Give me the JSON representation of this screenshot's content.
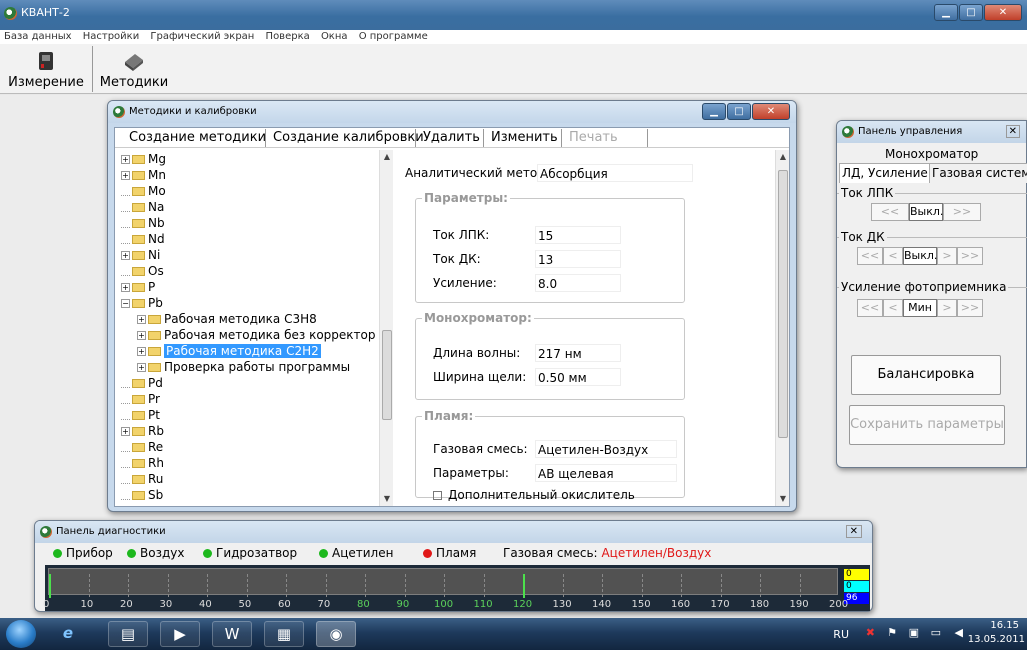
{
  "app": {
    "title": "КВАНТ-2"
  },
  "menu": [
    "База данных",
    "Настройки",
    "Графический экран",
    "Поверка",
    "Окна",
    "О программе"
  ],
  "toolbar": {
    "measure": "Измерение",
    "methods": "Методики"
  },
  "methods_window": {
    "title": "Методики и калибровки",
    "tabs": [
      "Создание методики",
      "Создание калибровки",
      "Удалить",
      "Изменить",
      "Печать"
    ],
    "tree": [
      {
        "label": "Mg",
        "expand": true,
        "level": 0
      },
      {
        "label": "Mn",
        "expand": true,
        "level": 0
      },
      {
        "label": "Mo",
        "expand": false,
        "level": 0
      },
      {
        "label": "Na",
        "expand": false,
        "level": 0
      },
      {
        "label": "Nb",
        "expand": false,
        "level": 0
      },
      {
        "label": "Nd",
        "expand": false,
        "level": 0
      },
      {
        "label": "Ni",
        "expand": true,
        "level": 0
      },
      {
        "label": "Os",
        "expand": false,
        "level": 0
      },
      {
        "label": "P",
        "expand": true,
        "level": 0
      },
      {
        "label": "Pb",
        "expand": true,
        "level": 0
      },
      {
        "label": "Рабочая методика C3H8",
        "expand": true,
        "level": 1
      },
      {
        "label": "Рабочая методика без корректор",
        "expand": true,
        "level": 1
      },
      {
        "label": "Рабочая методика C2H2",
        "expand": true,
        "level": 1,
        "selected": true
      },
      {
        "label": "Проверка работы программы",
        "expand": true,
        "level": 1
      },
      {
        "label": "Pd",
        "expand": false,
        "level": 0
      },
      {
        "label": "Pr",
        "expand": false,
        "level": 0
      },
      {
        "label": "Pt",
        "expand": false,
        "level": 0
      },
      {
        "label": "Rb",
        "expand": true,
        "level": 0
      },
      {
        "label": "Re",
        "expand": false,
        "level": 0
      },
      {
        "label": "Rh",
        "expand": false,
        "level": 0
      },
      {
        "label": "Ru",
        "expand": false,
        "level": 0
      },
      {
        "label": "Sb",
        "expand": false,
        "level": 0
      }
    ],
    "method_label": "Аналитический метод:",
    "method_value": "Абсорбция",
    "params_group": "Параметры:",
    "lpk_label": "Ток ЛПК:",
    "lpk_value": "15",
    "dk_label": "Ток ДК:",
    "dk_value": "13",
    "gain_label": "Усиление:",
    "gain_value": "8.0",
    "mono_group": "Монохроматор:",
    "wave_label": "Длина волны:",
    "wave_value": "217 нм",
    "slit_label": "Ширина щели:",
    "slit_value": "0.50 мм",
    "flame_group": "Пламя:",
    "gas_label": "Газовая смесь:",
    "gas_value": "Ацетилен-Воздух",
    "fparams_label": "Параметры:",
    "fparams_value": "АВ щелевая",
    "oxidizer_label": "Дополнительный окислитель"
  },
  "control_panel": {
    "title": "Панель управления",
    "heading": "Монохроматор",
    "tab1": "ЛД, Усиление",
    "tab2": "Газовая система",
    "lpk_group": "Ток ЛПК",
    "lpk_btns": [
      "<<",
      "Выкл.",
      ">>"
    ],
    "dk_group": "Ток ДК",
    "dk_btns": [
      "<<",
      "<",
      "Выкл.",
      ">",
      ">>"
    ],
    "gain_group": "Усиление фотоприемника",
    "gain_btns": [
      "<<",
      "<",
      "Мин",
      ">",
      ">>"
    ],
    "balance": "Балансировка",
    "save": "Сохранить параметры"
  },
  "diag_panel": {
    "title": "Панель диагностики",
    "items": [
      {
        "label": "Прибор",
        "color": "#1db81d"
      },
      {
        "label": "Воздух",
        "color": "#1db81d"
      },
      {
        "label": "Гидрозатвор",
        "color": "#1db81d"
      },
      {
        "label": "Ацетилен",
        "color": "#1db81d"
      },
      {
        "label": "Пламя",
        "color": "#e01818"
      }
    ],
    "gas_label": "Газовая смесь:",
    "gas_value": "Ацетилен/Воздух",
    "scale_ticks": [
      "0",
      "10",
      "20",
      "30",
      "40",
      "50",
      "60",
      "70",
      "80",
      "90",
      "100",
      "110",
      "120",
      "130",
      "140",
      "150",
      "160",
      "170",
      "180",
      "190",
      "200"
    ],
    "green_ticks": [
      "80",
      "90",
      "100",
      "110",
      "120"
    ],
    "marker_positions": [
      0,
      120
    ],
    "indicators": [
      {
        "value": "0",
        "color": "#ffff00"
      },
      {
        "value": "0",
        "color": "#00ffff"
      },
      {
        "value": "96",
        "color": "#0000ff"
      }
    ]
  },
  "taskbar": {
    "lang": "RU",
    "time": "16.15",
    "date": "13.05.2011"
  }
}
